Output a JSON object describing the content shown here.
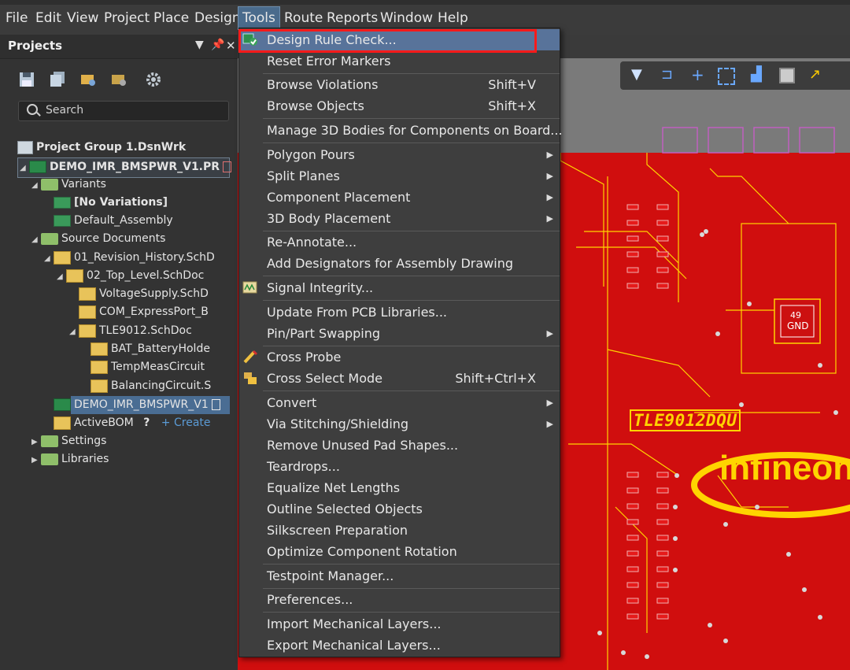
{
  "menubar": {
    "file": "File",
    "edit": "Edit",
    "view": "View",
    "project": "Project",
    "place": "Place",
    "design": "Design",
    "tools": "Tools",
    "route": "Route",
    "reports": "Reports",
    "window": "Window",
    "help": "Help"
  },
  "panel": {
    "title": "Projects",
    "search_placeholder": "Search",
    "tree": {
      "group": "Project Group 1.DsnWrk",
      "project": "DEMO_IMR_BMSPWR_V1.PR",
      "variants": "Variants",
      "no_variations": "[No Variations]",
      "default_assembly": "Default_Assembly",
      "source_documents": "Source Documents",
      "rev_history": "01_Revision_History.SchD",
      "top_level": "02_Top_Level.SchDoc",
      "voltage_supply": "VoltageSupply.SchD",
      "com_express": "COM_ExpressPort_B",
      "tle9012": "TLE9012.SchDoc",
      "bat_holder": "BAT_BatteryHolde",
      "temp_meas": "TempMeasCircuit",
      "balancing": "BalancingCircuit.S",
      "pcb_doc": "DEMO_IMR_BMSPWR_V1",
      "active_bom": "ActiveBOM",
      "create": "+ Create",
      "settings": "Settings",
      "libraries": "Libraries"
    }
  },
  "pcb": {
    "chip_label": "TLE9012DQU",
    "logo": "infineon",
    "pin": "49",
    "net": "GND"
  },
  "menu": {
    "design_rule_check": "Design Rule Check...",
    "reset_error_markers": "Reset Error Markers",
    "browse_violations": "Browse Violations",
    "browse_violations_sc": "Shift+V",
    "browse_objects": "Browse Objects",
    "browse_objects_sc": "Shift+X",
    "manage_3d": "Manage 3D Bodies for Components on Board...",
    "polygon_pours": "Polygon Pours",
    "split_planes": "Split Planes",
    "component_placement": "Component Placement",
    "body_placement": "3D Body Placement",
    "re_annotate": "Re-Annotate...",
    "add_designators": "Add Designators for Assembly Drawing",
    "signal_integrity": "Signal Integrity...",
    "update_from_pcb": "Update From PCB Libraries...",
    "pin_swapping": "Pin/Part Swapping",
    "cross_probe": "Cross Probe",
    "cross_select": "Cross Select Mode",
    "cross_select_sc": "Shift+Ctrl+X",
    "convert": "Convert",
    "via_stitching": "Via Stitching/Shielding",
    "remove_unused": "Remove Unused Pad Shapes...",
    "teardrops": "Teardrops...",
    "equalize": "Equalize Net Lengths",
    "outline": "Outline Selected Objects",
    "silkscreen": "Silkscreen Preparation",
    "optimize_rotation": "Optimize Component Rotation",
    "testpoint": "Testpoint Manager...",
    "preferences": "Preferences...",
    "import_mech": "Import Mechanical Layers...",
    "export_mech": "Export Mechanical Layers..."
  },
  "colors": {
    "board": "#d00e0e",
    "highlight": "#58739a",
    "callout": "#ff1a1a",
    "silk": "#ffd400"
  }
}
